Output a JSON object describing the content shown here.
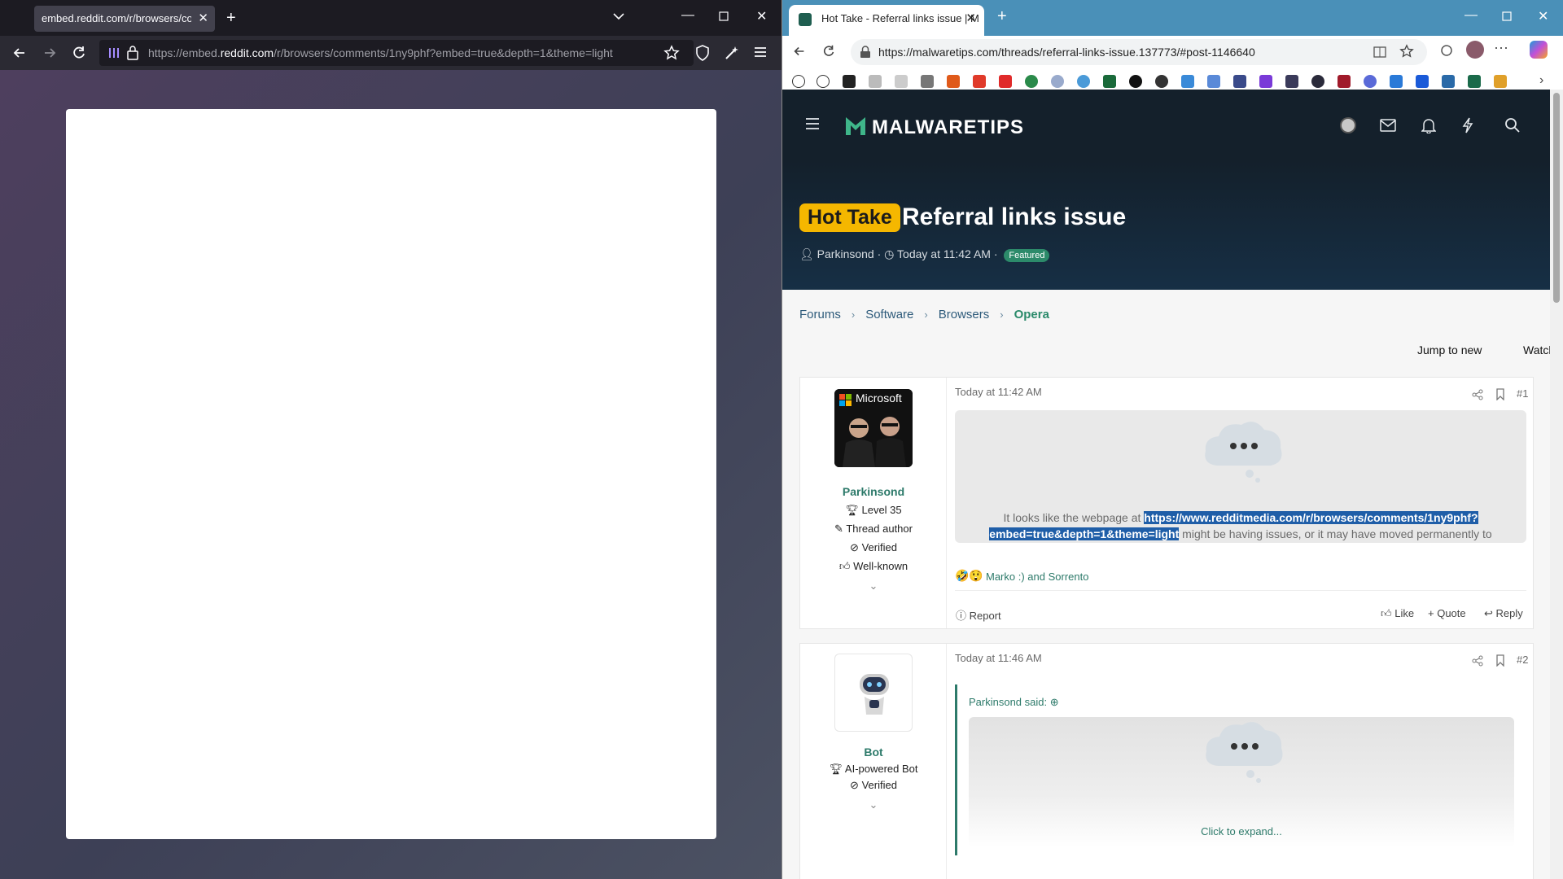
{
  "left_window": {
    "tab_title": "embed.reddit.com/r/browsers/comm",
    "url_prefix": "https://embed.",
    "url_domain": "reddit.com",
    "url_suffix": "/r/browsers/comments/1ny9phf?embed=true&depth=1&theme=light"
  },
  "right_window": {
    "tab_title": "Hot Take - Referral links issue | M",
    "url": "https://malwaretips.com/threads/referral-links-issue.137773/#post-1146640",
    "site": {
      "logo": "MALWARETIPS",
      "prefix": "Hot Take",
      "title": "Referral links issue",
      "author": "Parkinsond",
      "time": "Today at 11:42 AM",
      "featured": "Featured",
      "breadcrumb": [
        "Forums",
        "Software",
        "Browsers",
        "Opera"
      ],
      "jump_to_new": "Jump to new",
      "watch": "Watch"
    },
    "posts": [
      {
        "date": "Today at 11:42 AM",
        "number": "#1",
        "avatar_text": "Microsoft",
        "user": "Parkinsond",
        "lines": [
          "Level 35",
          "Thread author",
          "Verified",
          "Well-known"
        ],
        "text_before": "It looks like the webpage at ",
        "link_part1": "https://www.redditmedia.com/r/browsers/comments/1ny9phf?",
        "link_part2": "embed=true&depth=1&theme=light",
        "text_after": " might be having issues, or it may have moved permanently to",
        "reactions": "Marko :) and Sorrento",
        "report": "Report",
        "like": "Like",
        "quote": "Quote",
        "reply": "Reply"
      },
      {
        "date": "Today at 11:46 AM",
        "number": "#2",
        "user": "Bot",
        "lines": [
          "AI-powered Bot",
          "Verified"
        ],
        "quote_author": "Parkinsond said:",
        "expand": "Click to expand..."
      }
    ]
  }
}
